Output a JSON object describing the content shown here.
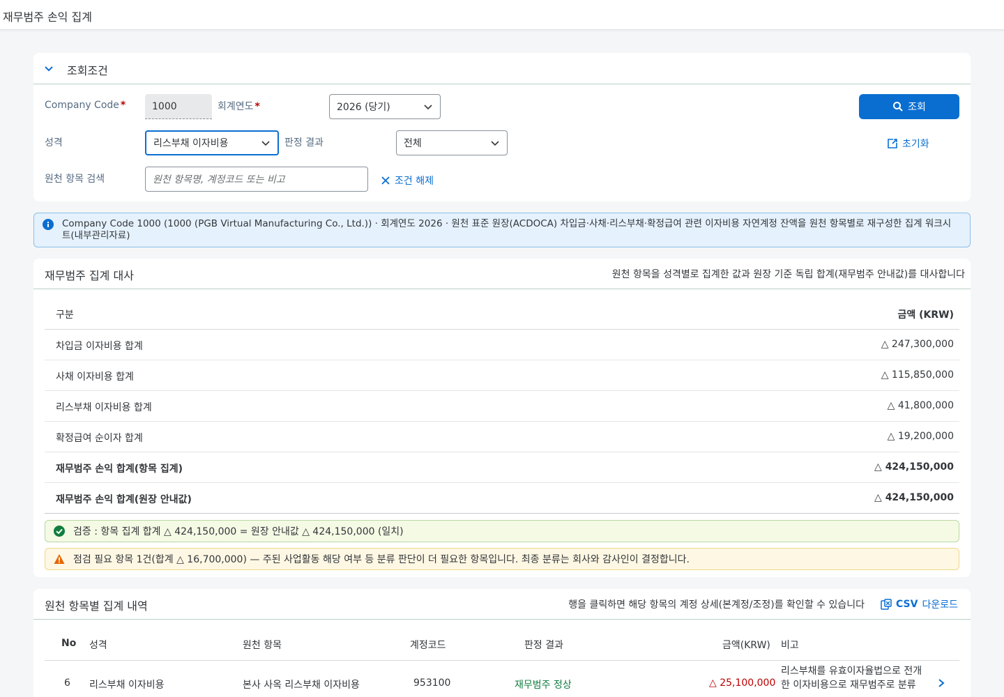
{
  "app": {
    "title": "재무범주 손익 집계"
  },
  "filter": {
    "header": "조회조건",
    "company_code_label": "Company Code",
    "company_code_value": "1000",
    "fiscal_year_label": "회계연도",
    "fiscal_year_value": "2026 (당기)",
    "nature_label": "성격",
    "nature_value": "리스부채 이자비용",
    "judgement_label": "판정 결과",
    "judgement_value": "전체",
    "search_label": "원천 항목 검색",
    "search_placeholder": "원천 항목명, 계정코드 또는 비고",
    "clear_label": "조건 해제",
    "search_button": "조회",
    "reset_label": "초기화",
    "required_mark": "*"
  },
  "info": {
    "text": "Company Code 1000 (1000 (PGB Virtual Manufacturing Co., Ltd.)) · 회계연도 2026 · 원천 표준 원장(ACDOCA) 차입금·사채·리스부채·확정급여 관련 이자비용 자연계정 잔액을 원천 항목별로 재구성한 집계 워크시트(내부관리자료)"
  },
  "summary": {
    "title": "재무범주 집계 대사",
    "note": "원천 항목을 성격별로 집계한 값과 원장 기준 독립 합계(재무범주 안내값)를 대사합니다",
    "col_label": "구분",
    "col_amount": "금액 (KRW)",
    "rows": [
      {
        "label": "차입금 이자비용 합계",
        "amount": "△ 247,300,000"
      },
      {
        "label": "사채 이자비용 합계",
        "amount": "△ 115,850,000"
      },
      {
        "label": "리스부채 이자비용 합계",
        "amount": "△ 41,800,000"
      },
      {
        "label": "확정급여 순이자 합계",
        "amount": "△ 19,200,000"
      },
      {
        "label": "재무범주 손익 합계(항목 집계)",
        "amount": "△ 424,150,000"
      },
      {
        "label": "재무범주 손익 합계(원장 안내값)",
        "amount": "△ 424,150,000"
      }
    ],
    "ok_message": "검증 : 항목 집계 합계 △ 424,150,000 = 원장 안내값 △ 424,150,000 (일치)",
    "warn_message": "점검 필요 항목 1건(합계 △ 16,700,000) — 주된 사업활동 해당 여부 등 분류 판단이 더 필요한 항목입니다. 최종 분류는 회사와 감사인이 결정합니다."
  },
  "detail": {
    "title": "원천 항목별 집계 내역",
    "note": "행을 클릭하면 해당 항목의 계정 상세(본계정/조정)를 확인할 수 있습니다",
    "csv_prefix": "CSV",
    "csv_label": "다운로드",
    "columns": {
      "no": "No",
      "nature": "성격",
      "item": "원천 항목",
      "account": "계정코드",
      "judgement": "판정 결과",
      "amount": "금액(KRW)",
      "remark": "비고"
    },
    "rows": [
      {
        "no": "6",
        "nature": "리스부채 이자비용",
        "item": "본사 사옥 리스부채 이자비용",
        "account": "953100",
        "judgement": "재무범주 정상",
        "amount": "△ 25,100,000",
        "remark": "리스부채를 유효이자율법으로 전개한 이자비용으로 재무범주로 분류"
      }
    ]
  },
  "colors": {
    "accent": "#0a6ed1",
    "negative": "#bb0000",
    "positive": "#107e3e",
    "warning": "#e76500"
  }
}
